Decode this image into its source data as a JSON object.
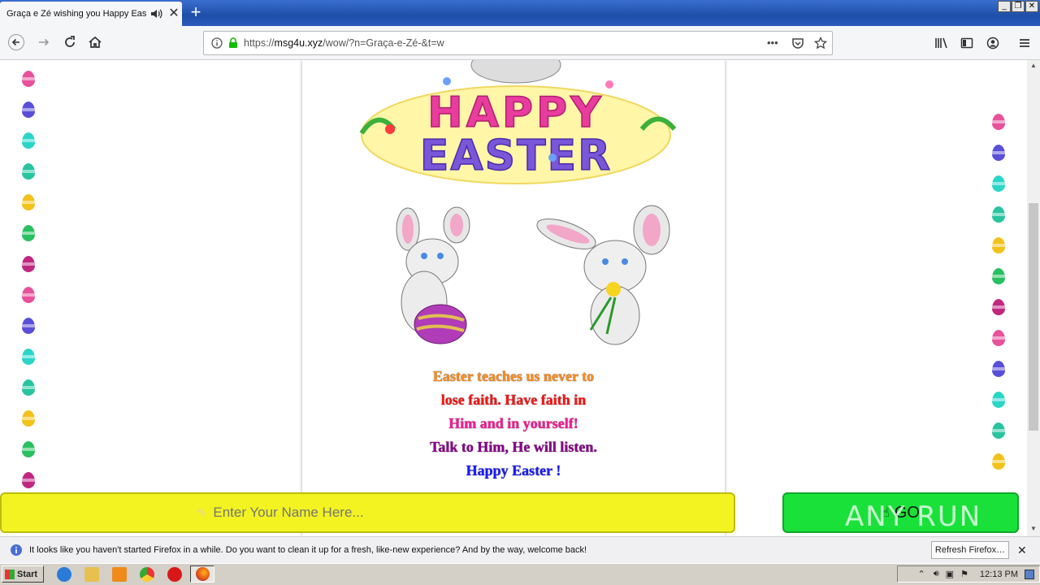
{
  "window": {
    "tab_title": "Graça e Zé wishing you Happy Easter",
    "close_tab_glyph": "✕",
    "new_tab_glyph": "+",
    "min_glyph": "_",
    "max_glyph": "❐",
    "close_glyph": "✕"
  },
  "navbar": {
    "url_prefix": "https://",
    "url_host": "msg4u.xyz",
    "url_path": "/wow/?n=Graça-e-Zé-&t=w",
    "page_actions_glyph": "•••"
  },
  "page": {
    "banner_text": "HAPPY EASTER",
    "message_lines": [
      {
        "text": "Easter teaches us never to",
        "color": "#ff8c1a"
      },
      {
        "text": "lose faith. Have faith in",
        "color": "#ff1010"
      },
      {
        "text": "Him and in yourself!",
        "color": "#ff1493"
      },
      {
        "text": "Talk to Him, He will listen.",
        "color": "#8b008b"
      },
      {
        "text": "Happy Easter !",
        "color": "#1a1aff"
      }
    ],
    "name_placeholder": "Enter Your Name Here...",
    "go_label": "GO",
    "watermark": "ANY RUN"
  },
  "notification": {
    "text": "It looks like you haven't started Firefox in a while. Do you want to clean it up for a fresh, like-new experience? And by the way, welcome back!",
    "refresh_label": "Refresh Firefox…",
    "close_glyph": "✕"
  },
  "taskbar": {
    "start_label": "Start",
    "clock": "12:13 PM"
  },
  "colors": {
    "egg_colors_left": [
      "#e8519c",
      "#5a4fd8",
      "#2ad6c8",
      "#28c4a0",
      "#f2c21a",
      "#28c060",
      "#c02880"
    ],
    "egg_colors_right": [
      "#e8519c",
      "#5a4fd8",
      "#2ad6c8",
      "#28c4a0",
      "#f2c21a",
      "#28c060",
      "#c02880"
    ]
  }
}
